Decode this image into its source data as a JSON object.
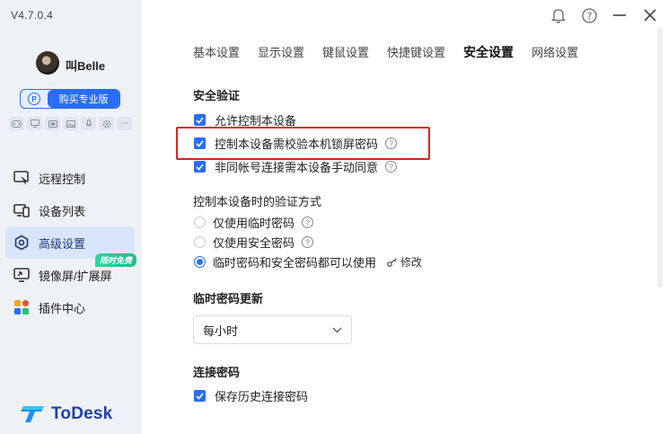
{
  "app": {
    "version": "V4.7.0.4",
    "logo_text": "ToDesk",
    "colors": {
      "accent": "#2a6df4",
      "highlight": "#e02020",
      "badge": "#1fbf86"
    }
  },
  "user": {
    "name": "叫Belle"
  },
  "upgrade_button": {
    "label": "购买专业版",
    "icon": "pro-p-icon"
  },
  "feature_icons": [
    "gamepad-icon",
    "monitor-icon",
    "screen-icon",
    "image-icon",
    "microphone-icon",
    "gear-icon",
    "more-icon"
  ],
  "sidebar": {
    "items": [
      {
        "label": "远程控制",
        "icon": "remote-control-icon"
      },
      {
        "label": "设备列表",
        "icon": "device-list-icon"
      },
      {
        "label": "高级设置",
        "icon": "advanced-settings-icon",
        "active": true
      },
      {
        "label": "镜像屏/扩展屏",
        "icon": "mirror-screen-icon",
        "badge": "限时免费"
      },
      {
        "label": "插件中心",
        "icon": "plugin-center-icon"
      }
    ]
  },
  "window_icons": [
    "bell-icon",
    "help-icon",
    "minimize-icon",
    "close-icon"
  ],
  "tabs": [
    {
      "label": "基本设置"
    },
    {
      "label": "显示设置"
    },
    {
      "label": "键鼠设置"
    },
    {
      "label": "快捷键设置"
    },
    {
      "label": "安全设置",
      "active": true
    },
    {
      "label": "网络设置"
    }
  ],
  "security": {
    "title": "安全验证",
    "options": [
      {
        "label": "允许控制本设备",
        "checked": true
      },
      {
        "label": "控制本设备需校验本机锁屏密码",
        "checked": true,
        "help": true
      },
      {
        "label": "非同帐号连接需本设备手动同意",
        "checked": true,
        "help": true
      }
    ]
  },
  "verify": {
    "title": "控制本设备时的验证方式",
    "options": [
      {
        "label": "仅使用临时密码",
        "selected": false
      },
      {
        "label": "仅使用安全密码",
        "selected": false
      },
      {
        "label": "临时密码和安全密码都可以使用",
        "selected": true
      }
    ],
    "modify_label": "修改"
  },
  "temp_password": {
    "title": "临时密码更新",
    "selected": "每小时"
  },
  "connect_password": {
    "title": "连接密码",
    "save_history_label": "保存历史连接密码",
    "checked": true
  }
}
